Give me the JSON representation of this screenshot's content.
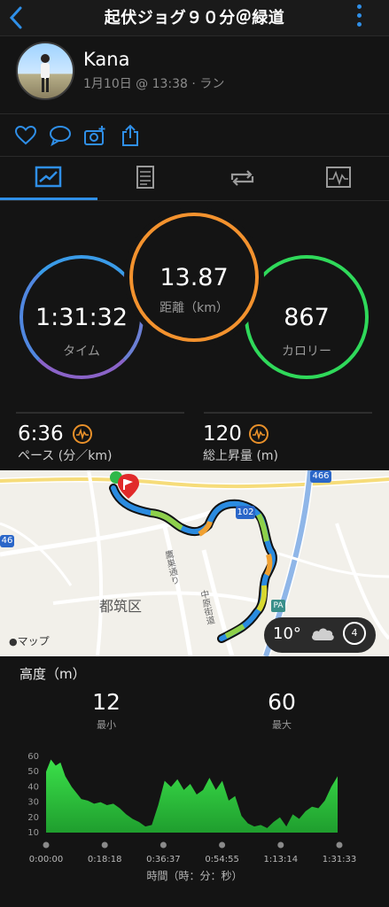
{
  "header": {
    "title": "起伏ジョグ９０分＠緑道"
  },
  "profile": {
    "name": "Kana",
    "meta": "1月10日 @ 13:38 · ラン"
  },
  "actions": [
    "heart-icon",
    "comment-icon",
    "add-photo-icon",
    "share-icon"
  ],
  "tabs": [
    "summary-tab",
    "details-tab",
    "laps-tab",
    "charts-tab"
  ],
  "circles": {
    "time": {
      "value": "1:31:32",
      "label": "タイム"
    },
    "distance": {
      "value": "13.87",
      "label": "距離（km）"
    },
    "calories": {
      "value": "867",
      "label": "カロリー"
    }
  },
  "stats": {
    "pace": {
      "value": "6:36",
      "label": "ペース (分／km)"
    },
    "ascent": {
      "value": "120",
      "label": "総上昇量 (m)"
    }
  },
  "map": {
    "labels": {
      "district": "都筑区",
      "road1": "鷹巣通り",
      "road2": "中原街道",
      "route_num": "102",
      "route_top": "466",
      "route_left": "46",
      "pa": "PA",
      "attribution": "マップ"
    },
    "weather": {
      "temp": "10°",
      "wind": "4"
    }
  },
  "elevation": {
    "title": "高度（m）",
    "min": {
      "value": "12",
      "label": "最小"
    },
    "max": {
      "value": "60",
      "label": "最大"
    }
  },
  "chart_data": {
    "type": "area",
    "title": "高度（m）",
    "xlabel": "時間（時：分：秒）",
    "ylabel": "",
    "x_ticks": [
      "0:00:00",
      "0:18:18",
      "0:36:37",
      "0:54:55",
      "1:13:14",
      "1:31:33"
    ],
    "y_ticks": [
      "60",
      "50",
      "40",
      "30",
      "20",
      "10"
    ],
    "ylim": [
      10,
      60
    ],
    "xlim_minutes": [
      0,
      91.55
    ],
    "series": [
      {
        "x_minutes": [
          0,
          1.5,
          3,
          4.5,
          6,
          8,
          9.5,
          11,
          13,
          15,
          17,
          19,
          21,
          23,
          25,
          27,
          29,
          31,
          33,
          35,
          37,
          39,
          41,
          43,
          45,
          47,
          49,
          51,
          53,
          55,
          57,
          59,
          61,
          63,
          65,
          67,
          69,
          71,
          73,
          75,
          77,
          79,
          81,
          83,
          85,
          87,
          89,
          91
        ],
        "values": [
          50,
          58,
          54,
          56,
          47,
          40,
          36,
          32,
          31,
          29,
          30,
          28,
          29,
          26,
          22,
          19,
          17,
          14,
          15,
          28,
          44,
          40,
          45,
          38,
          42,
          35,
          38,
          46,
          38,
          44,
          31,
          34,
          21,
          16,
          14,
          15,
          13,
          17,
          20,
          14,
          22,
          19,
          24,
          27,
          26,
          31,
          40,
          47
        ]
      }
    ],
    "fill_color": "#31d03c"
  }
}
